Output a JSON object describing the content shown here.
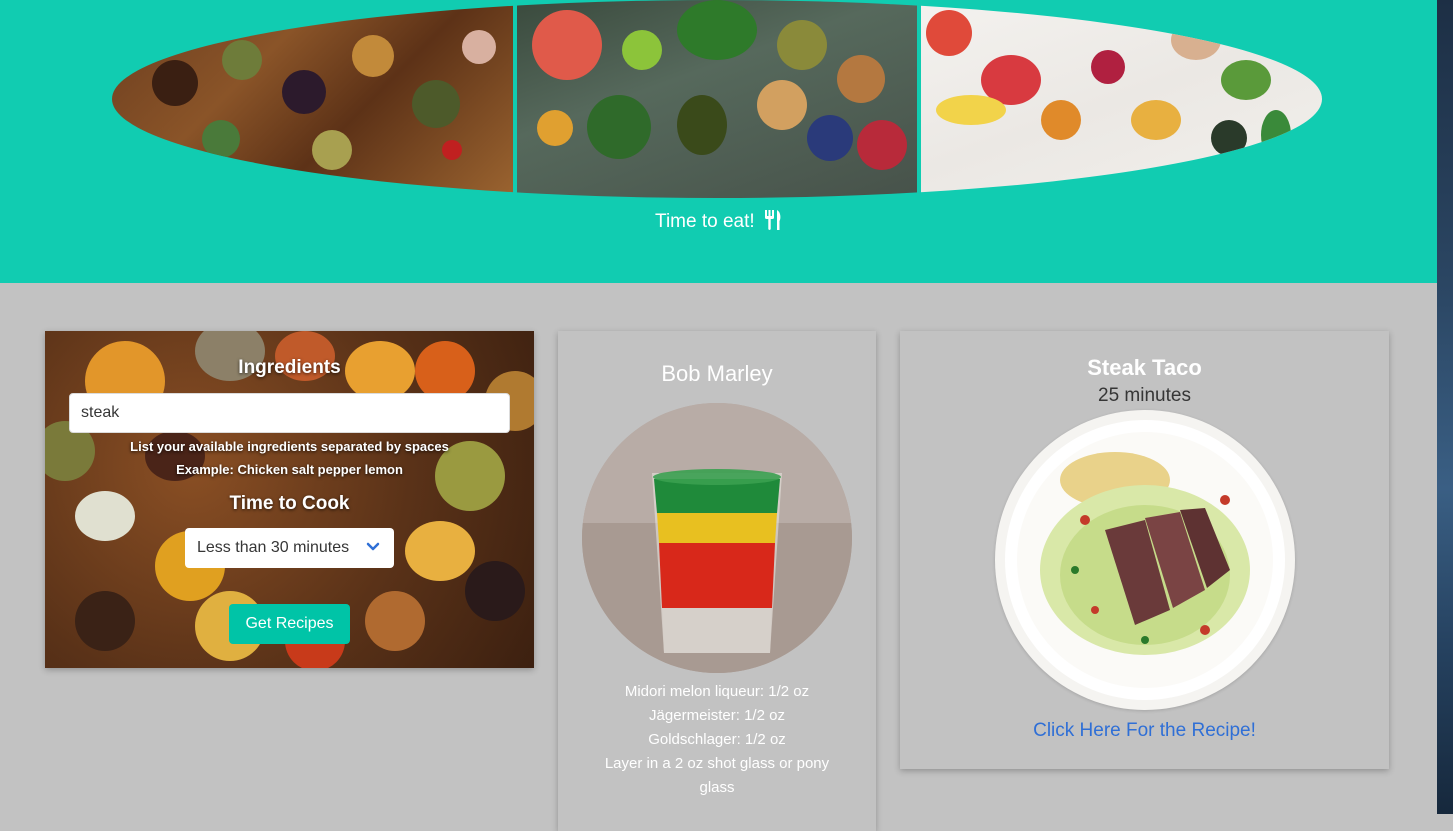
{
  "hero": {
    "images": [
      "spices-spoons-image",
      "vegetables-bowls-image",
      "fruits-vegetables-image"
    ],
    "tagline": "Time to eat!",
    "tagline_icon": "utensils-icon",
    "background": "#11ccb1"
  },
  "search": {
    "title": "Ingredients",
    "input_value": "steak",
    "help_line_1": "List your available ingredients separated by spaces",
    "help_line_2": "Example: Chicken salt pepper lemon",
    "time_title": "Time to Cook",
    "time_selected": "Less than 30 minutes",
    "button_label": "Get Recipes",
    "button_color": "#00c4a7"
  },
  "drink": {
    "name": "Bob Marley",
    "image": "layered-shot-glass-image",
    "ingredients": [
      "Midori melon liqueur: 1/2 oz",
      "Jägermeister: 1/2 oz",
      "Goldschlager: 1/2 oz",
      "Layer in a 2 oz shot glass or pony glass"
    ]
  },
  "recipe": {
    "name": "Steak Taco",
    "time": "25 minutes",
    "image": "steak-taco-salad-image",
    "link_label": "Click Here For the Recipe!",
    "link_color": "#2f6fd6"
  }
}
